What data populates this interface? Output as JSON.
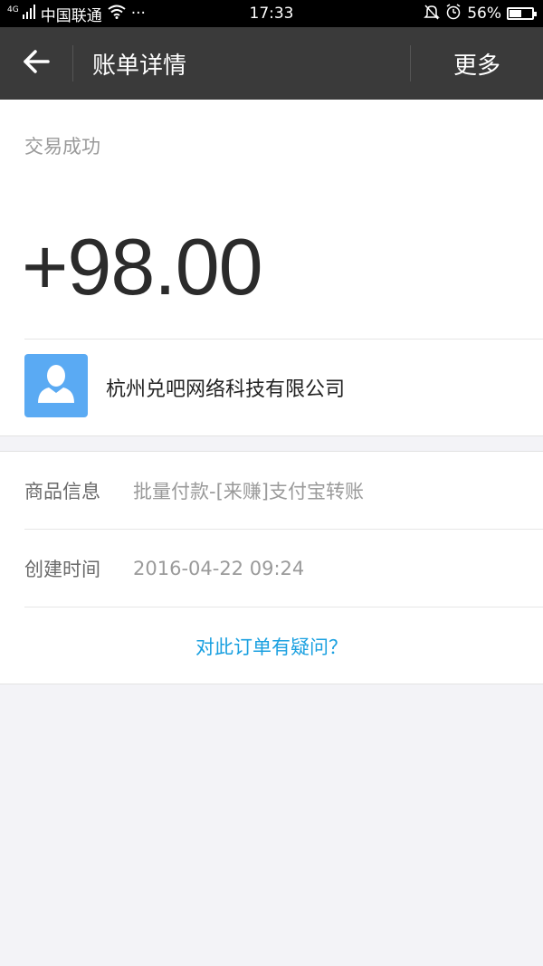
{
  "status_bar": {
    "signal_label": "4G",
    "carrier": "中国联通",
    "dots": "···",
    "time": "17:33",
    "battery": "56%",
    "battery_level": 0.56
  },
  "header": {
    "title": "账单详情",
    "more_label": "更多"
  },
  "summary": {
    "status": "交易成功",
    "amount": "+98.00",
    "merchant": "杭州兑吧网络科技有限公司"
  },
  "details": [
    {
      "label": "商品信息",
      "value": "批量付款-[来赚]支付宝转账"
    },
    {
      "label": "创建时间",
      "value": "2016-04-22 09:24"
    }
  ],
  "question_link": "对此订单有疑问？",
  "colors": {
    "header_bg": "#3a3a3a",
    "link": "#1aa0e0",
    "avatar_bg": "#5aaaf3"
  }
}
